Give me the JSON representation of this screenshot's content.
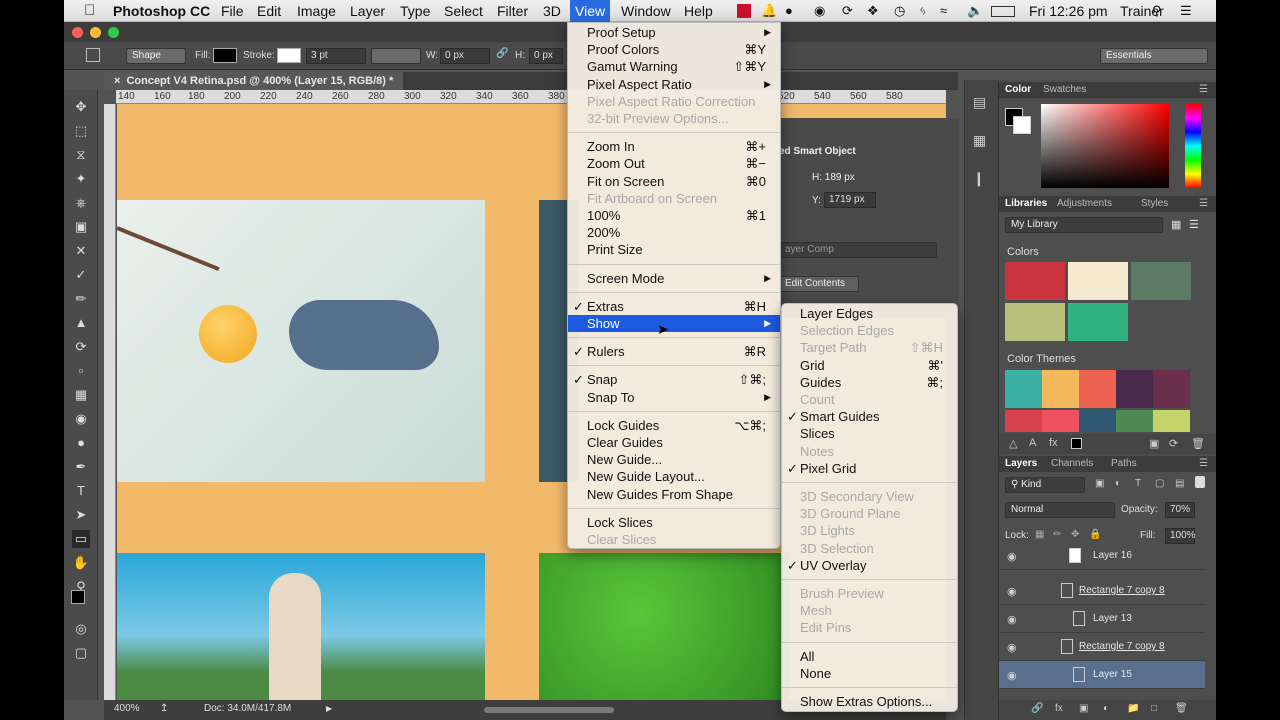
{
  "menubar": {
    "app": "Photoshop CC",
    "items": [
      "File",
      "Edit",
      "Image",
      "Layer",
      "Type",
      "Select",
      "Filter",
      "3D",
      "View",
      "Window",
      "Help"
    ],
    "selected": "View",
    "clock": "Fri 12:26 pm",
    "user": "Trainer"
  },
  "options": {
    "shape_mode": "Shape",
    "fill_label": "Fill:",
    "stroke_label": "Stroke:",
    "stroke_width": "3 pt",
    "w_label": "W:",
    "w_value": "0 px",
    "h_label": "H:",
    "h_value": "0 px",
    "workspace": "Essentials"
  },
  "document": {
    "tab_title": "Concept V4 Retina.psd @ 400% (Layer 15, RGB/8) *",
    "ruler_ticks": [
      "140",
      "160",
      "180",
      "200",
      "220",
      "240",
      "260",
      "280",
      "300",
      "320",
      "340",
      "360",
      "380",
      "520",
      "540",
      "560",
      "580"
    ],
    "zoom": "400%",
    "doc_size": "Doc: 34.0M/417.8M"
  },
  "properties": {
    "title": "ed Smart Object",
    "h": "H: 189 px",
    "y_label": "Y:",
    "y": "1719 px",
    "layer_comp": "ayer Comp",
    "edit_contents": "Edit Contents"
  },
  "view_menu": [
    {
      "label": "Proof Setup",
      "shortcut": "",
      "submenu": true,
      "disabled": false,
      "checked": false
    },
    {
      "label": "Proof Colors",
      "shortcut": "⌘Y",
      "submenu": false,
      "disabled": false,
      "checked": false
    },
    {
      "label": "Gamut Warning",
      "shortcut": "⇧⌘Y",
      "submenu": false,
      "disabled": false,
      "checked": false
    },
    {
      "label": "Pixel Aspect Ratio",
      "shortcut": "",
      "submenu": true,
      "disabled": false,
      "checked": false
    },
    {
      "label": "Pixel Aspect Ratio Correction",
      "shortcut": "",
      "submenu": false,
      "disabled": true,
      "checked": false
    },
    {
      "label": "32-bit Preview Options...",
      "shortcut": "",
      "submenu": false,
      "disabled": true,
      "checked": false
    },
    {
      "sep": true
    },
    {
      "label": "Zoom In",
      "shortcut": "⌘+",
      "submenu": false,
      "disabled": false,
      "checked": false
    },
    {
      "label": "Zoom Out",
      "shortcut": "⌘−",
      "submenu": false,
      "disabled": false,
      "checked": false
    },
    {
      "label": "Fit on Screen",
      "shortcut": "⌘0",
      "submenu": false,
      "disabled": false,
      "checked": false
    },
    {
      "label": "Fit Artboard on Screen",
      "shortcut": "",
      "submenu": false,
      "disabled": true,
      "checked": false
    },
    {
      "label": "100%",
      "shortcut": "⌘1",
      "submenu": false,
      "disabled": false,
      "checked": false
    },
    {
      "label": "200%",
      "shortcut": "",
      "submenu": false,
      "disabled": false,
      "checked": false
    },
    {
      "label": "Print Size",
      "shortcut": "",
      "submenu": false,
      "disabled": false,
      "checked": false
    },
    {
      "sep": true
    },
    {
      "label": "Screen Mode",
      "shortcut": "",
      "submenu": true,
      "disabled": false,
      "checked": false
    },
    {
      "sep": true
    },
    {
      "label": "Extras",
      "shortcut": "⌘H",
      "submenu": false,
      "disabled": false,
      "checked": true
    },
    {
      "label": "Show",
      "shortcut": "",
      "submenu": true,
      "disabled": false,
      "checked": false,
      "highlighted": true
    },
    {
      "sep": true
    },
    {
      "label": "Rulers",
      "shortcut": "⌘R",
      "submenu": false,
      "disabled": false,
      "checked": true
    },
    {
      "sep": true
    },
    {
      "label": "Snap",
      "shortcut": "⇧⌘;",
      "submenu": false,
      "disabled": false,
      "checked": true
    },
    {
      "label": "Snap To",
      "shortcut": "",
      "submenu": true,
      "disabled": false,
      "checked": false
    },
    {
      "sep": true
    },
    {
      "label": "Lock Guides",
      "shortcut": "⌥⌘;",
      "submenu": false,
      "disabled": false,
      "checked": false
    },
    {
      "label": "Clear Guides",
      "shortcut": "",
      "submenu": false,
      "disabled": false,
      "checked": false
    },
    {
      "label": "New Guide...",
      "shortcut": "",
      "submenu": false,
      "disabled": false,
      "checked": false
    },
    {
      "label": "New Guide Layout...",
      "shortcut": "",
      "submenu": false,
      "disabled": false,
      "checked": false
    },
    {
      "label": "New Guides From Shape",
      "shortcut": "",
      "submenu": false,
      "disabled": false,
      "checked": false
    },
    {
      "sep": true
    },
    {
      "label": "Lock Slices",
      "shortcut": "",
      "submenu": false,
      "disabled": false,
      "checked": false
    },
    {
      "label": "Clear Slices",
      "shortcut": "",
      "submenu": false,
      "disabled": true,
      "checked": false
    }
  ],
  "show_menu": [
    {
      "label": "Layer Edges",
      "shortcut": "",
      "disabled": false,
      "checked": false
    },
    {
      "label": "Selection Edges",
      "shortcut": "",
      "disabled": true,
      "checked": false
    },
    {
      "label": "Target Path",
      "shortcut": "⇧⌘H",
      "disabled": true,
      "checked": false
    },
    {
      "label": "Grid",
      "shortcut": "⌘'",
      "disabled": false,
      "checked": false
    },
    {
      "label": "Guides",
      "shortcut": "⌘;",
      "disabled": false,
      "checked": false
    },
    {
      "label": "Count",
      "shortcut": "",
      "disabled": true,
      "checked": false
    },
    {
      "label": "Smart Guides",
      "shortcut": "",
      "disabled": false,
      "checked": true
    },
    {
      "label": "Slices",
      "shortcut": "",
      "disabled": false,
      "checked": false
    },
    {
      "label": "Notes",
      "shortcut": "",
      "disabled": true,
      "checked": false
    },
    {
      "label": "Pixel Grid",
      "shortcut": "",
      "disabled": false,
      "checked": true
    },
    {
      "sep": true
    },
    {
      "label": "3D Secondary View",
      "shortcut": "",
      "disabled": true,
      "checked": false
    },
    {
      "label": "3D Ground Plane",
      "shortcut": "",
      "disabled": true,
      "checked": false
    },
    {
      "label": "3D Lights",
      "shortcut": "",
      "disabled": true,
      "checked": false
    },
    {
      "label": "3D Selection",
      "shortcut": "",
      "disabled": true,
      "checked": false
    },
    {
      "label": "UV Overlay",
      "shortcut": "",
      "disabled": false,
      "checked": true
    },
    {
      "sep": true
    },
    {
      "label": "Brush Preview",
      "shortcut": "",
      "disabled": true,
      "checked": false
    },
    {
      "label": "Mesh",
      "shortcut": "",
      "disabled": true,
      "checked": false
    },
    {
      "label": "Edit Pins",
      "shortcut": "",
      "disabled": true,
      "checked": false
    },
    {
      "sep": true
    },
    {
      "label": "All",
      "shortcut": "",
      "disabled": false,
      "checked": false
    },
    {
      "label": "None",
      "shortcut": "",
      "disabled": false,
      "checked": false
    },
    {
      "sep": true
    },
    {
      "label": "Show Extras Options...",
      "shortcut": "",
      "disabled": false,
      "checked": false
    }
  ],
  "color_panel": {
    "tabs": [
      "Color",
      "Swatches"
    ]
  },
  "libraries_panel": {
    "tabs": [
      "Libraries",
      "Adjustments",
      "Styles"
    ],
    "library": "My Library",
    "colors_heading": "Colors",
    "colors": [
      "#c9343f",
      "#f5ead0",
      "#5d7a64",
      "#b9c27c",
      "#2fb27e"
    ],
    "themes_heading": "Color Themes",
    "themes": [
      [
        "#3cb0a5",
        "#f4b85d",
        "#ec6451",
        "#4b2b4d",
        "#6b2f4e"
      ],
      [
        "#d8414e",
        "#ef4f5e",
        "#2f5672",
        "#4e8a52",
        "#c5d36b"
      ]
    ]
  },
  "layers_panel": {
    "tabs": [
      "Layers",
      "Channels",
      "Paths"
    ],
    "kind": "Kind",
    "blend": "Normal",
    "opacity_label": "Opacity:",
    "opacity": "70%",
    "lock_label": "Lock:",
    "fill_label": "Fill:",
    "fill": "100%",
    "layers": [
      "Layer 16",
      "Rectangle 7 copy 8",
      "Layer 13",
      "Rectangle 7 copy 8",
      "Layer 15"
    ],
    "selected_index": 4
  }
}
